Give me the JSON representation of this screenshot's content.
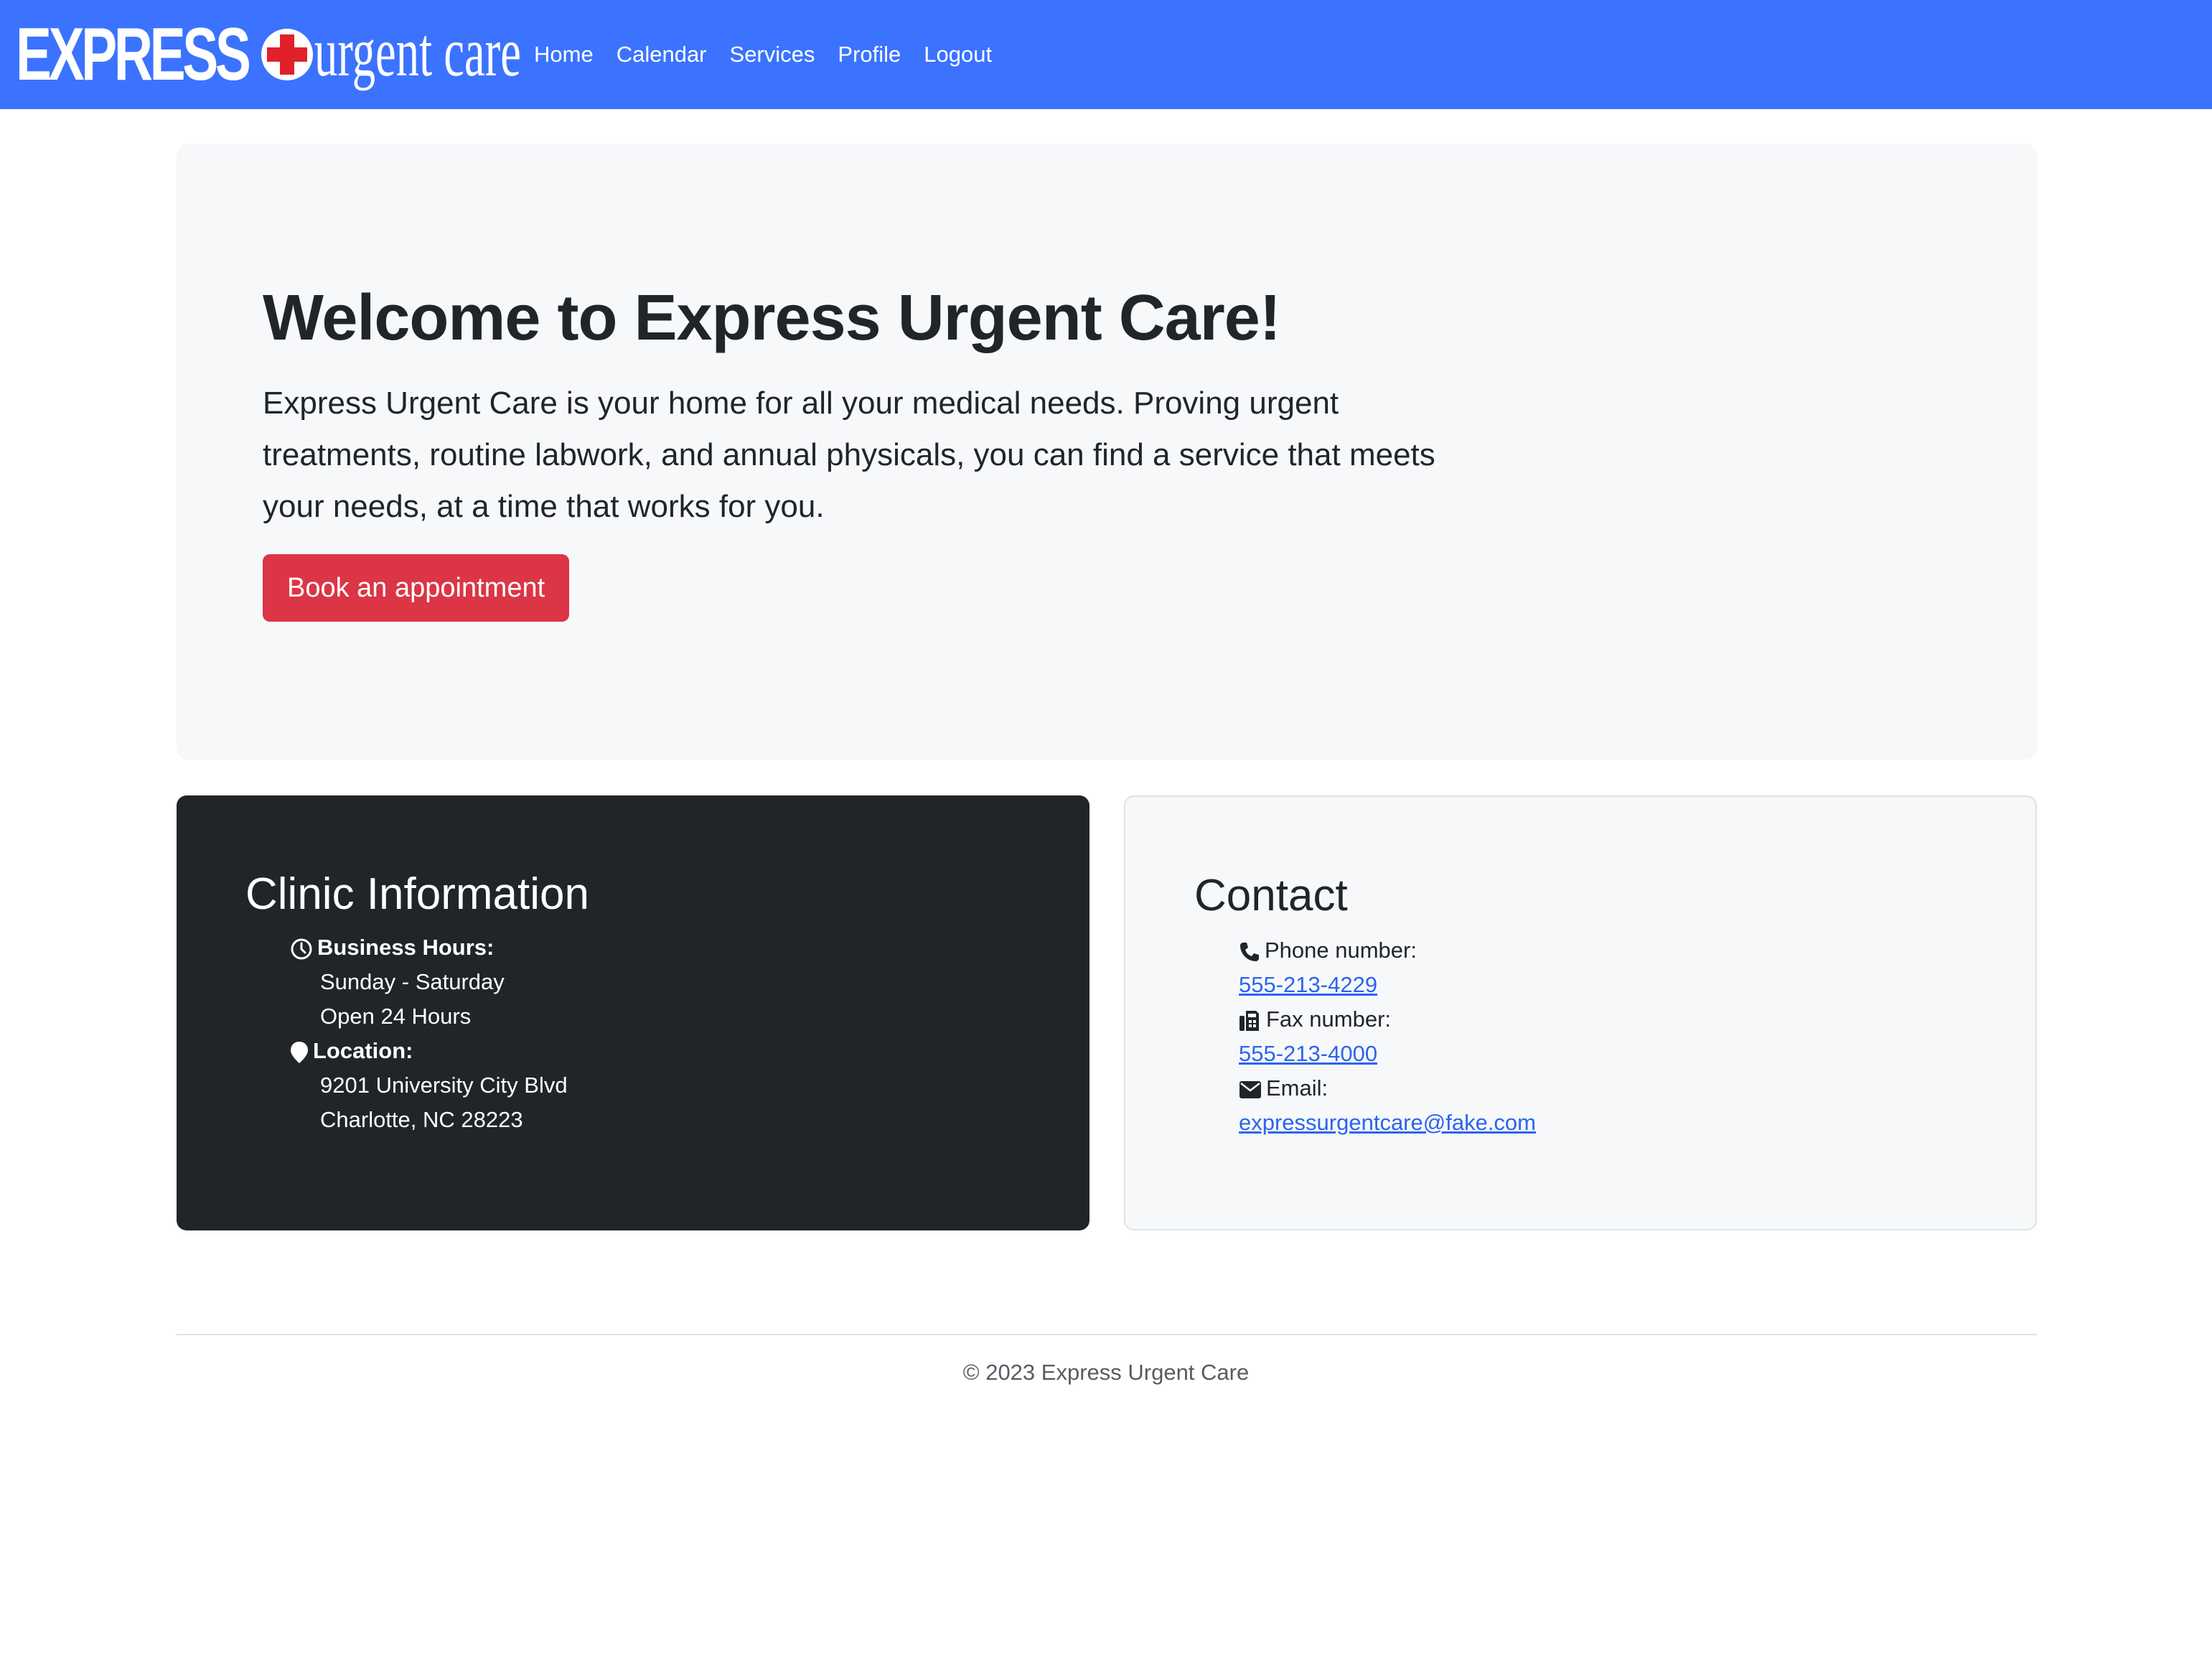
{
  "brand": {
    "express": "EXPRESS",
    "urgent_care": "urgent care",
    "cross_color": "#e0202a"
  },
  "nav": {
    "items": [
      {
        "label": "Home"
      },
      {
        "label": "Calendar"
      },
      {
        "label": "Services"
      },
      {
        "label": "Profile"
      },
      {
        "label": "Logout"
      }
    ]
  },
  "hero": {
    "title": "Welcome to Express Urgent Care!",
    "description": "Express Urgent Care is your home for all your medical needs. Proving urgent treatments, routine labwork, and annual physicals, you can find a service that meets your needs, at a time that works for you.",
    "button_label": "Book an appointment"
  },
  "clinic": {
    "title": "Clinic Information",
    "hours_label": "Business Hours:",
    "hours_days": "Sunday - Saturday",
    "hours_time": "Open 24 Hours",
    "location_label": "Location:",
    "address_line1": "9201 University City Blvd",
    "address_line2": "Charlotte, NC 28223"
  },
  "contact": {
    "title": "Contact",
    "phone_label": "Phone number:",
    "phone_value": "555-213-4229",
    "fax_label": "Fax number:",
    "fax_value": "555-213-4000",
    "email_label": "Email:",
    "email_value": "expressurgentcare@fake.com"
  },
  "footer": {
    "text": "© 2023 Express Urgent Care"
  },
  "colors": {
    "navbar": "#3b73ff",
    "primary_button": "#dc3545",
    "dark_card": "#212529",
    "link": "#2b64f0"
  }
}
